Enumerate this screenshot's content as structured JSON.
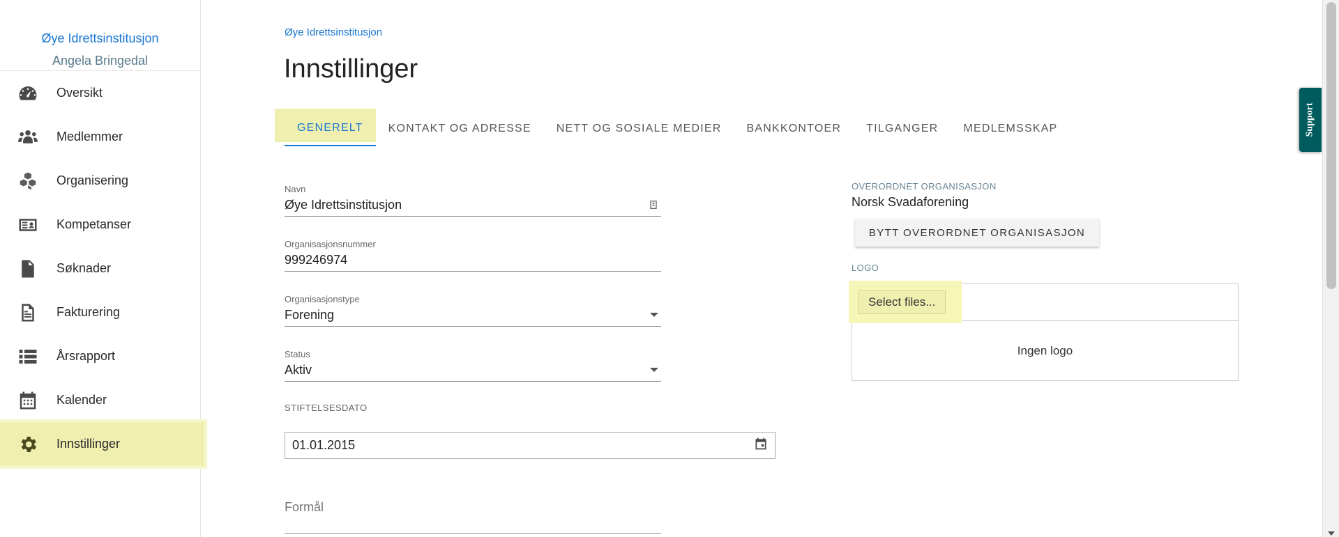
{
  "sidebar": {
    "org_name": "Øye Idrettsinstitusjon",
    "user_name": "Angela Bringedal",
    "items": [
      {
        "label": "Oversikt",
        "icon": "speedometer-icon"
      },
      {
        "label": "Medlemmer",
        "icon": "people-icon"
      },
      {
        "label": "Organisering",
        "icon": "cubes-icon"
      },
      {
        "label": "Kompetanser",
        "icon": "id-card-icon"
      },
      {
        "label": "Søknader",
        "icon": "document-icon"
      },
      {
        "label": "Fakturering",
        "icon": "invoice-icon"
      },
      {
        "label": "Årsrapport",
        "icon": "list-icon"
      },
      {
        "label": "Kalender",
        "icon": "calendar-icon"
      },
      {
        "label": "Innstillinger",
        "icon": "gear-icon",
        "active": true
      }
    ]
  },
  "header": {
    "breadcrumb": "Øye Idrettsinstitusjon",
    "title": "Innstillinger"
  },
  "tabs": [
    {
      "label": "GENERELT",
      "active": true
    },
    {
      "label": "KONTAKT OG ADRESSE"
    },
    {
      "label": "NETT OG SOSIALE MEDIER"
    },
    {
      "label": "BANKKONTOER"
    },
    {
      "label": "TILGANGER"
    },
    {
      "label": "MEDLEMSSKAP"
    }
  ],
  "form": {
    "name": {
      "label": "Navn",
      "value": "Øye Idrettsinstitusjon"
    },
    "orgnr": {
      "label": "Organisasjonsnummer",
      "value": "999246974"
    },
    "orgtype": {
      "label": "Organisasjonstype",
      "value": "Forening"
    },
    "status": {
      "label": "Status",
      "value": "Aktiv"
    },
    "founded": {
      "label": "STIFTELSESDATO",
      "value": "01.01.2015"
    },
    "purpose": {
      "label": "Formål"
    }
  },
  "parent_org": {
    "label": "OVERORDNET ORGANISASJON",
    "value": "Norsk Svadaforening",
    "button": "BYTT OVERORDNET ORGANISASJON"
  },
  "logo": {
    "label": "LOGO",
    "select_button": "Select files...",
    "empty_text": "Ingen logo"
  },
  "support": {
    "label": "Support"
  },
  "colors": {
    "accent": "#1976d2",
    "highlight": "#efefb0",
    "support_bg": "#005b5e"
  }
}
